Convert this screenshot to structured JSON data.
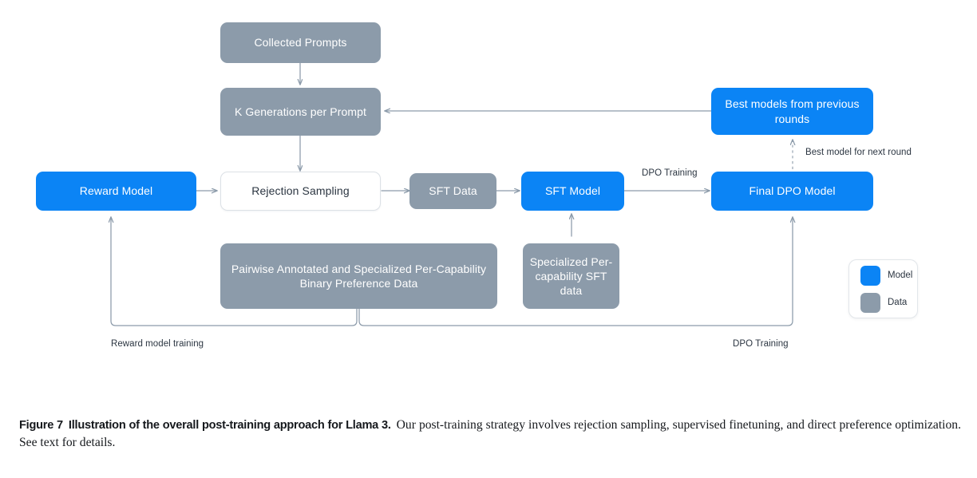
{
  "figure": {
    "caption_label": "Figure 7",
    "caption_title": "Illustration of the overall post-training approach for Llama 3.",
    "caption_body": "Our post-training strategy involves rejection sampling, supervised finetuning, and direct preference optimization. See text for details."
  },
  "colors": {
    "model": "#0B84F5",
    "data": "#8C9BAA",
    "plain_bg": "#FFFFFF",
    "plain_border": "#DCE1E6",
    "wire": "#8C9BAA",
    "text_dark": "#2B3541"
  },
  "diagram": {
    "nodes": [
      {
        "id": "collected_prompts",
        "label": "Collected Prompts",
        "kind": "data"
      },
      {
        "id": "k_generations",
        "label": "K Generations per Prompt",
        "kind": "data"
      },
      {
        "id": "reward_model",
        "label": "Reward Model",
        "kind": "model"
      },
      {
        "id": "rejection_sampling",
        "label": "Rejection Sampling",
        "kind": "plain"
      },
      {
        "id": "sft_data",
        "label": "SFT Data",
        "kind": "data"
      },
      {
        "id": "sft_model",
        "label": "SFT Model",
        "kind": "model"
      },
      {
        "id": "final_dpo_model",
        "label": "Final DPO Model",
        "kind": "model"
      },
      {
        "id": "best_models",
        "label": "Best models from previous rounds",
        "kind": "model"
      },
      {
        "id": "pairwise_data",
        "label": "Pairwise Annotated and Specialized Per-Capability Binary Preference Data",
        "kind": "data"
      },
      {
        "id": "specialized_sft_data",
        "label": "Specialized Per-capability SFT data",
        "kind": "data"
      }
    ],
    "edge_labels": {
      "dpo_training_top": "DPO Training",
      "best_model_next_round": "Best model for next round",
      "reward_model_training": "Reward model training",
      "dpo_training_bottom": "DPO Training"
    }
  },
  "legend": {
    "items": [
      {
        "label": "Model",
        "color": "#0B84F5"
      },
      {
        "label": "Data",
        "color": "#8C9BAA"
      }
    ]
  }
}
